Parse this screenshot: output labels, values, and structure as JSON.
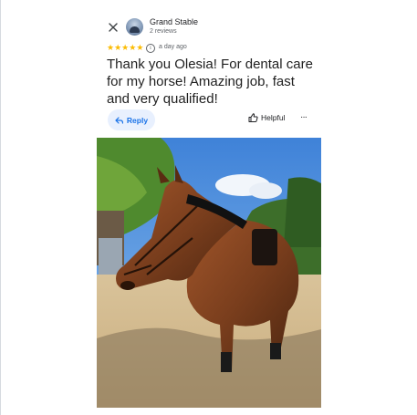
{
  "place": {
    "name": "Grand Stable",
    "reviews": "2 reviews"
  },
  "review": {
    "rating": 5,
    "stars": [
      "★",
      "★",
      "★",
      "★",
      "★"
    ],
    "info_glyph": "i",
    "time": "a day ago",
    "text": "Thank you Olesia! For dental care for my horse! Amazing job, fast and very qualified!"
  },
  "actions": {
    "reply": "Reply",
    "helpful": "Helpful",
    "more": "···"
  },
  "icons": [
    "close-icon",
    "avatar",
    "star-icon",
    "info-icon",
    "reply-arrow-icon",
    "thumbs-up-icon",
    "more-icon"
  ],
  "colors": {
    "star": "#fbbc04",
    "accent": "#1a73e8",
    "reply_bg": "#e8f0fe",
    "text": "#1f1f1f",
    "muted": "#5f6368"
  }
}
